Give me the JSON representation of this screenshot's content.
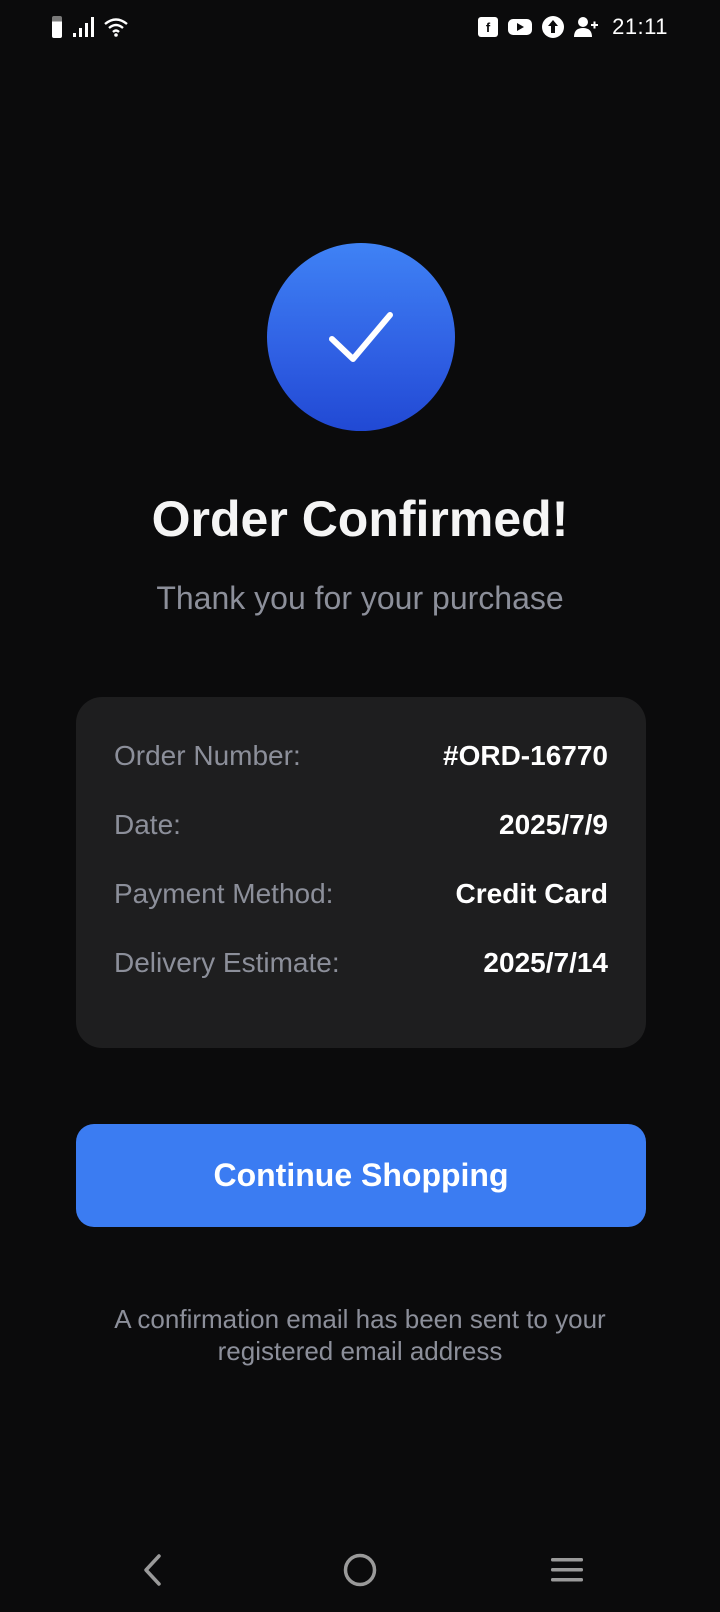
{
  "status_bar": {
    "time": "21:11",
    "left_icons": [
      "battery-icon",
      "signal-icon",
      "wifi-icon"
    ],
    "right_icons": [
      "facebook-icon",
      "youtube-icon",
      "upload-icon",
      "add-contact-icon"
    ]
  },
  "confirmation": {
    "icon": "checkmark-icon",
    "title": "Order Confirmed!",
    "subtitle": "Thank you for your purchase"
  },
  "details": {
    "order_number": {
      "label": "Order Number:",
      "value": "#ORD-16770"
    },
    "date": {
      "label": "Date:",
      "value": "2025/7/9"
    },
    "payment_method": {
      "label": "Payment Method:",
      "value": "Credit Card"
    },
    "delivery_estimate": {
      "label": "Delivery Estimate:",
      "value": "2025/7/14"
    }
  },
  "actions": {
    "continue_label": "Continue Shopping"
  },
  "note": "A confirmation email has been sent to your registered email address",
  "nav": {
    "icons": [
      "back-icon",
      "home-icon",
      "menu-icon"
    ]
  },
  "colors": {
    "background": "#0b0b0c",
    "card": "#1e1e1f",
    "accent": "#3b7cf2",
    "muted_text": "#8c8f9a"
  }
}
